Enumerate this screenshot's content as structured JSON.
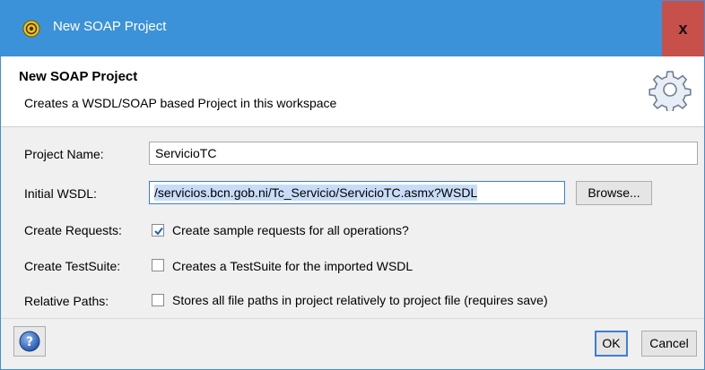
{
  "window": {
    "title": "New SOAP Project",
    "close_label": "x"
  },
  "header": {
    "title": "New SOAP Project",
    "subtitle": "Creates a WSDL/SOAP based Project in this workspace"
  },
  "form": {
    "project_name": {
      "label": "Project Name:",
      "value": "ServicioTC"
    },
    "initial_wsdl": {
      "label": "Initial WSDL:",
      "value": "/servicios.bcn.gob.ni/Tc_Servicio/ServicioTC.asmx?WSDL",
      "browse_label": "Browse..."
    },
    "create_requests": {
      "label": "Create Requests:",
      "checkbox_label": "Create sample requests for all operations?",
      "checked": true
    },
    "create_testsuite": {
      "label": "Create TestSuite:",
      "checkbox_label": "Creates a TestSuite for the imported WSDL",
      "checked": false
    },
    "relative_paths": {
      "label": "Relative Paths:",
      "checkbox_label": "Stores all file paths in project relatively to project file (requires save)",
      "checked": false
    }
  },
  "footer": {
    "ok_label": "OK",
    "cancel_label": "Cancel"
  },
  "colors": {
    "titlebar": "#3c92d8",
    "close": "#c7504b",
    "focus": "#3c7fd3"
  }
}
